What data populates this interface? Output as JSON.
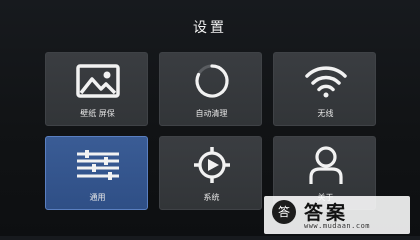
{
  "header": {
    "title": "设置"
  },
  "tiles": [
    {
      "label": "壁纸 屏保",
      "icon": "image-icon"
    },
    {
      "label": "自动清理",
      "icon": "cleanup-ring-icon"
    },
    {
      "label": "无线",
      "icon": "wifi-icon"
    },
    {
      "label": "通用",
      "icon": "sliders-icon",
      "selected": true
    },
    {
      "label": "系统",
      "icon": "system-gear-icon"
    },
    {
      "label": "关于",
      "icon": "user-icon"
    }
  ],
  "watermark": {
    "logo": "答",
    "text": "答案",
    "url": "www.mudaan.com"
  },
  "colors": {
    "selected_tile": "#2f4f86",
    "tile": "#353839",
    "background": "#121417"
  }
}
